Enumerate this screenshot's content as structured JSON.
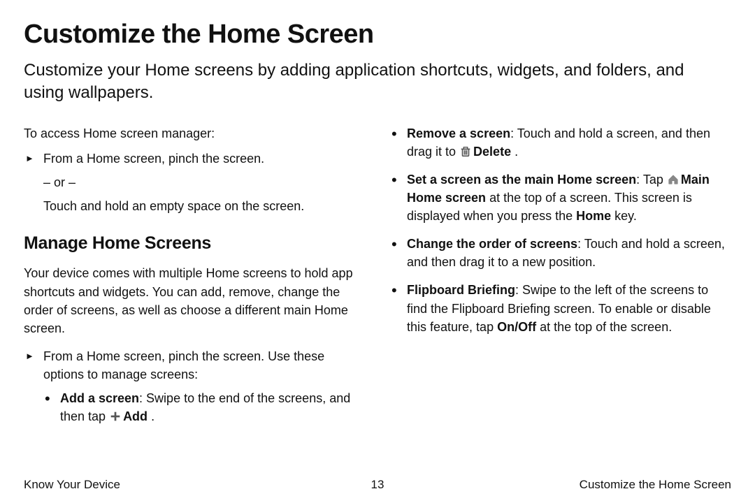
{
  "title": "Customize the Home Screen",
  "intro": "Customize your Home screens by adding application shortcuts, widgets, and folders, and using wallpapers.",
  "left": {
    "access_intro": "To access Home screen manager:",
    "pinch": "From a Home screen, pinch the screen.",
    "or": "– or –",
    "touch_hold": "Touch and hold an empty space on the screen.",
    "manage_heading": "Manage Home Screens",
    "manage_intro": "Your device comes with multiple Home screens to hold app shortcuts and widgets. You can add, remove, change the order of screens, as well as choose a different main Home screen.",
    "manage_pinch": "From a Home screen, pinch the screen. Use these options to manage screens:",
    "add_label": "Add a screen",
    "add_text": ": Swipe to the end of the screens, and then tap ",
    "add_icon_label": "Add",
    "add_period": " ."
  },
  "right": {
    "remove_label": "Remove a screen",
    "remove_text1": ": Touch and hold a screen, and then drag it to ",
    "remove_icon_label": "Delete",
    "remove_period": " .",
    "main_label": "Set a screen as the main Home screen",
    "main_text1": ": Tap ",
    "main_icon_label": "Main Home screen",
    "main_text2": "  at the top of a screen. This screen is displayed when you press the ",
    "main_home_key": "Home",
    "main_text3": " key.",
    "order_label": "Change the order of screens",
    "order_text": ": Touch and hold a screen, and then drag it to a new position.",
    "flip_label": "Flipboard Briefing",
    "flip_text1": ": Swipe to the left of the screens to find the Flipboard Briefing screen. To enable or disable this feature, tap ",
    "flip_onoff": "On/Off",
    "flip_text2": " at the top of the screen."
  },
  "footer": {
    "left": "Know Your Device",
    "center": "13",
    "right": "Customize the Home Screen"
  }
}
